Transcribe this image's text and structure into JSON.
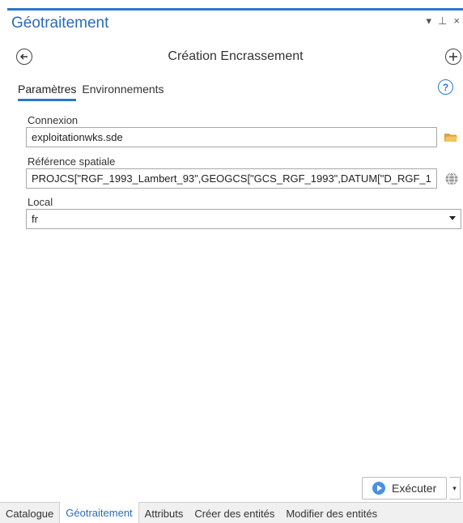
{
  "pane": {
    "title": "Géotraitement",
    "controls": {
      "menu": "▾",
      "pin": "⊥",
      "close": "×"
    }
  },
  "tool": {
    "title": "Création Encrassement"
  },
  "tabs": [
    {
      "label": "Paramètres",
      "active": true
    },
    {
      "label": "Environnements",
      "active": false
    }
  ],
  "help_symbol": "?",
  "parameters": {
    "connexion": {
      "label": "Connexion",
      "value": "exploitationwks.sde"
    },
    "reference_spatiale": {
      "label": "Référence spatiale",
      "value": "PROJCS[\"RGF_1993_Lambert_93\",GEOGCS[\"GCS_RGF_1993\",DATUM[\"D_RGF_1"
    },
    "local": {
      "label": "Local",
      "value": "fr"
    }
  },
  "run": {
    "label": "Exécuter",
    "menu_arrow": "▾"
  },
  "bottom_tabs": [
    {
      "label": "Catalogue",
      "active": false
    },
    {
      "label": "Géotraitement",
      "active": true
    },
    {
      "label": "Attributs",
      "active": false
    },
    {
      "label": "Créer des entités",
      "active": false
    },
    {
      "label": "Modifier des entités",
      "active": false
    }
  ],
  "colors": {
    "accent": "#2b78c5",
    "title": "#2b6cb8",
    "folder": "#e8b64a"
  },
  "icons": {
    "back": "back-arrow-icon",
    "add": "plus-circle-icon",
    "help": "help-icon",
    "folder": "folder-open-icon",
    "globe": "globe-icon",
    "run": "play-icon"
  }
}
